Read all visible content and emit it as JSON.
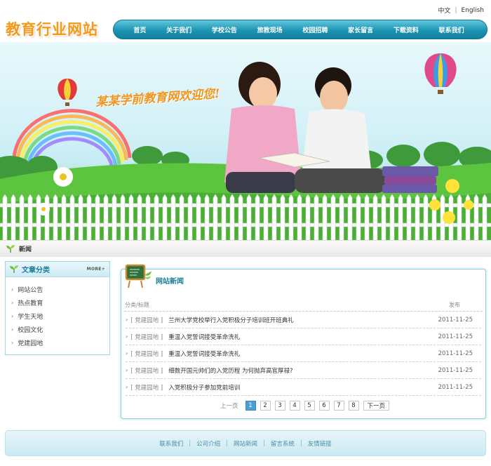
{
  "header": {
    "logo": "教育行业网站",
    "lang": [
      "中文",
      "English"
    ],
    "lang_sep": "|"
  },
  "nav": [
    "首页",
    "关于我们",
    "学校公告",
    "旅教现场",
    "校园招聘",
    "家长留言",
    "下载资料",
    "联系我们"
  ],
  "banner": {
    "welcome": "某某学前教育网欢迎您!"
  },
  "breadcrumb": {
    "label": "新闻"
  },
  "sidebar": {
    "title": "文章分类",
    "more": "MORE+",
    "items": [
      "网站公告",
      "热点教育",
      "学生天地",
      "校园文化",
      "党建园地"
    ]
  },
  "news": {
    "title": "网站新闻",
    "col_left": "分类/标题",
    "col_right": "发布",
    "items": [
      {
        "cat": "[ 党建园地 ]",
        "title": "兰州大学党校举行入党积极分子培训班开班典礼",
        "date": "2011-11-25"
      },
      {
        "cat": "[ 党建园地 ]",
        "title": "重温入党誓词接受革命洗礼",
        "date": "2011-11-25"
      },
      {
        "cat": "[ 党建园地 ]",
        "title": "重温入党誓词接受革命洗礼",
        "date": "2011-11-25"
      },
      {
        "cat": "[ 党建园地 ]",
        "title": "细数开国元帅们的入党历程 为何抛弃高官厚禄?",
        "date": "2011-11-25"
      },
      {
        "cat": "[ 党建园地 ]",
        "title": "入党积极分子参加党前培训",
        "date": "2011-11-25"
      }
    ]
  },
  "pager": {
    "prev": "上一页",
    "pages": [
      "1",
      "2",
      "3",
      "4",
      "5",
      "6",
      "7",
      "8"
    ],
    "current": 1,
    "next": "下一页"
  },
  "footer": {
    "links": [
      "联系我们",
      "公司介绍",
      "网站新闻",
      "留言系统",
      "友情链接"
    ],
    "sep": "|"
  },
  "colors": {
    "accent": "#1b94b3",
    "logo": "#f39a1b",
    "pager_active": "#4c9ed6"
  }
}
